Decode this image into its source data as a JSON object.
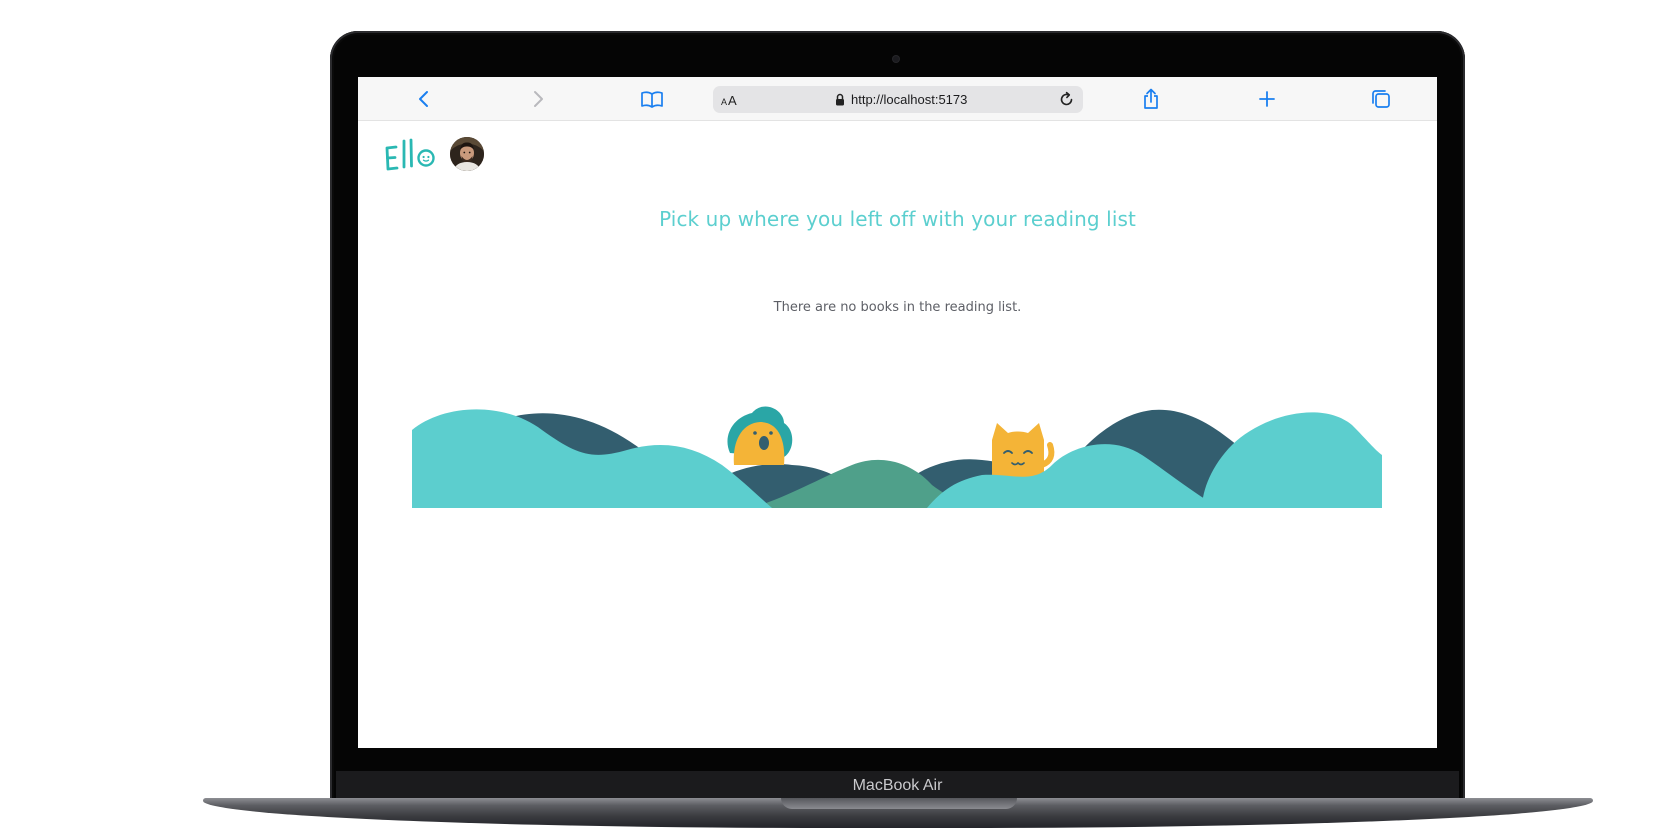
{
  "device": {
    "model_label": "MacBook Air"
  },
  "browser": {
    "address": {
      "url": "http://localhost:5173",
      "text_size_label_small": "A",
      "text_size_label_large": "A"
    },
    "toolbar_icons": [
      "back-icon",
      "forward-icon",
      "bookmarks-icon",
      "share-icon",
      "new-tab-icon",
      "tabs-icon"
    ],
    "accent_color": "#1a7ff0"
  },
  "app": {
    "brand_color": "#2ab8b3",
    "headline": "Pick up where you left off with your reading list",
    "headline_color": "#5ccfcf",
    "empty_message": "There are no books in the reading list.",
    "illustration": {
      "colors": {
        "light_teal": "#5ccece",
        "dark_slate": "#335e6f",
        "green": "#4fa08a",
        "yellow": "#f4b437"
      }
    }
  }
}
